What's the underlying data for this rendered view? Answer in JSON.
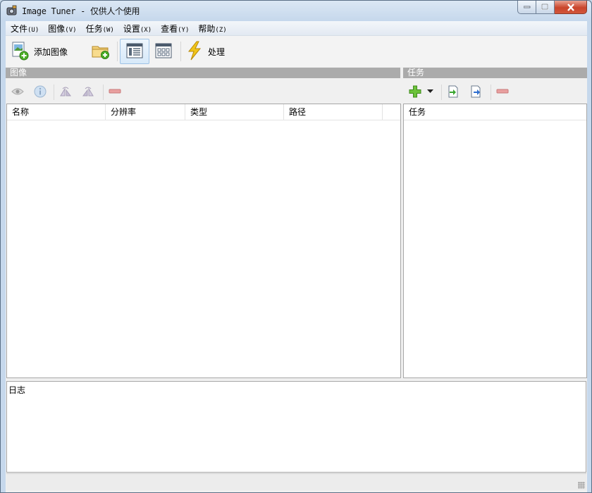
{
  "window": {
    "title": "Image Tuner - 仅供人个使用"
  },
  "menu": [
    {
      "label": "文件",
      "accel": "(U)"
    },
    {
      "label": "图像",
      "accel": "(V)"
    },
    {
      "label": "任务",
      "accel": "(W)"
    },
    {
      "label": "设置",
      "accel": "(X)"
    },
    {
      "label": "查看",
      "accel": "(Y)"
    },
    {
      "label": "帮助",
      "accel": "(Z)"
    }
  ],
  "toolbar": {
    "add_image_label": "添加图像",
    "process_label": "处理"
  },
  "images_panel": {
    "header": "图像",
    "columns": [
      "名称",
      "分辨率",
      "类型",
      "路径"
    ]
  },
  "tasks_panel": {
    "header": "任务",
    "columns": [
      "任务"
    ]
  },
  "log": {
    "label": "日志"
  },
  "colors": {
    "section_header": "#ababab",
    "add_green": "#4caf27",
    "remove_red": "#e07a7a",
    "process_yellow": "#f0c419"
  }
}
